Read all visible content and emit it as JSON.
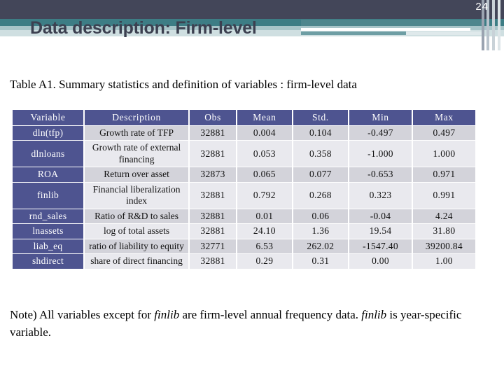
{
  "slide": {
    "page_number": "24",
    "title": "Data description: Firm-level",
    "accent_dark": "#434659",
    "accent_teal": "#3d7d85",
    "table_header_color": "#4e5490"
  },
  "table": {
    "caption": "Table A1. Summary statistics and definition of variables : firm-level data",
    "columns": [
      "Variable",
      "Description",
      "Obs",
      "Mean",
      "Std.",
      "Min",
      "Max"
    ],
    "rows": [
      {
        "variable": "dln(tfp)",
        "description": "Growth rate of TFP",
        "obs": "32881",
        "mean": "0.004",
        "std": "0.104",
        "min": "-0.497",
        "max": "0.497"
      },
      {
        "variable": "dlnloans",
        "description": "Growth rate of external financing",
        "obs": "32881",
        "mean": "0.053",
        "std": "0.358",
        "min": "-1.000",
        "max": "1.000"
      },
      {
        "variable": "ROA",
        "description": "Return over asset",
        "obs": "32873",
        "mean": "0.065",
        "std": "0.077",
        "min": "-0.653",
        "max": "0.971"
      },
      {
        "variable": "finlib",
        "description": "Financial liberalization index",
        "obs": "32881",
        "mean": "0.792",
        "std": "0.268",
        "min": "0.323",
        "max": "0.991"
      },
      {
        "variable": "rnd_sales",
        "description": "Ratio of R&D to sales",
        "obs": "32881",
        "mean": "0.01",
        "std": "0.06",
        "min": "-0.04",
        "max": "4.24"
      },
      {
        "variable": "lnassets",
        "description": "log of total assets",
        "obs": "32881",
        "mean": "24.10",
        "std": "1.36",
        "min": "19.54",
        "max": "31.80"
      },
      {
        "variable": "liab_eq",
        "description": "ratio of liability to equity",
        "obs": "32771",
        "mean": "6.53",
        "std": "262.02",
        "min": "-1547.40",
        "max": "39200.84"
      },
      {
        "variable": "shdirect",
        "description": "share of direct financing",
        "obs": "32881",
        "mean": "0.29",
        "std": "0.31",
        "min": "0.00",
        "max": "1.00"
      }
    ]
  },
  "note": {
    "part1": "Note) All variables except for ",
    "em1": "finlib",
    "part2": " are firm-level annual frequency data. ",
    "em2": "finlib",
    "part3": " is year-specific variable."
  }
}
